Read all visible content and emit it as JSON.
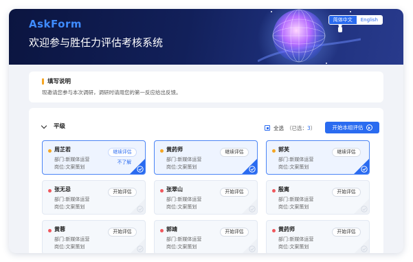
{
  "header": {
    "brand": "AskForm",
    "title": "欢迎参与胜任力评估考核系统",
    "lang_active": "简体中文",
    "lang_other": "English"
  },
  "notice": {
    "heading": "填写说明",
    "text": "现邀请您参与本次调研，调研时请用您的第一反应给出反馈。"
  },
  "group": {
    "title": "平级",
    "select_all_label": "全选",
    "selected_prefix": "（已选：",
    "selected_count": "3",
    "selected_suffix": "）",
    "start_button": "开始本组评估"
  },
  "cards": [
    {
      "name": "周芷若",
      "dept": "部门:新媒体运营",
      "role": "岗位:文案策划",
      "button": "继续评估",
      "extra": "不了解",
      "selected": true,
      "dot_color": "#f6a623",
      "button_style": "blue"
    },
    {
      "name": "黄药师",
      "dept": "部门:新媒体运营",
      "role": "岗位:文案策划",
      "button": "继续评估",
      "extra": "",
      "selected": true,
      "dot_color": "#f6a623",
      "button_style": "normal"
    },
    {
      "name": "郭芙",
      "dept": "部门:新媒体运营",
      "role": "岗位:文案策划",
      "button": "继续评估",
      "extra": "",
      "selected": true,
      "dot_color": "#f6a623",
      "button_style": "normal"
    },
    {
      "name": "张无忌",
      "dept": "部门:新媒体运营",
      "role": "岗位:文案策划",
      "button": "开始评估",
      "extra": "",
      "selected": false,
      "dot_color": "#f0575d",
      "button_style": "normal"
    },
    {
      "name": "张翠山",
      "dept": "部门:新媒体运营",
      "role": "岗位:文案策划",
      "button": "开始评估",
      "extra": "",
      "selected": false,
      "dot_color": "#f0575d",
      "button_style": "normal"
    },
    {
      "name": "殷离",
      "dept": "部门:新媒体运营",
      "role": "岗位:文案策划",
      "button": "开始评估",
      "extra": "",
      "selected": false,
      "dot_color": "#f0575d",
      "button_style": "normal"
    },
    {
      "name": "黄蓉",
      "dept": "部门:新媒体运营",
      "role": "岗位:文案策划",
      "button": "开始评估",
      "extra": "",
      "selected": false,
      "dot_color": "#f0575d",
      "button_style": "normal"
    },
    {
      "name": "郭靖",
      "dept": "部门:新媒体运营",
      "role": "岗位:文案策划",
      "button": "开始评估",
      "extra": "",
      "selected": false,
      "dot_color": "#f0575d",
      "button_style": "normal"
    },
    {
      "name": "黄药师",
      "dept": "部门:新媒体运营",
      "role": "岗位:文案策划",
      "button": "开始评估",
      "extra": "",
      "selected": false,
      "dot_color": "#f0575d",
      "button_style": "normal"
    }
  ],
  "icons": {
    "collapse": "chevron-down-icon",
    "play": "play-circle-icon",
    "check": "check-corner-icon"
  },
  "colors": {
    "accent": "#2a6bf0",
    "pending_dot": "#f6a623",
    "new_dot": "#f0575d"
  }
}
